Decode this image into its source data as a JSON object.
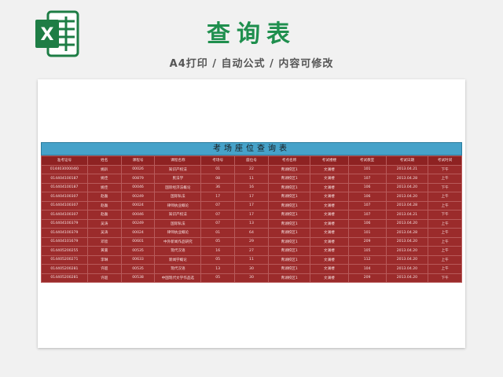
{
  "header": {
    "title": "查询表",
    "subtitle": "A4打印 / 自动公式 / 内容可修改"
  },
  "table": {
    "title": "考场座位查询表",
    "columns": [
      "准考证号",
      "姓名",
      "课程号",
      "课程名称",
      "考场号",
      "座位号",
      "考点名称",
      "考试楼楼",
      "考试教室",
      "考试日期",
      "考试时间"
    ],
    "rows": [
      [
        "01440300004l0",
        "姚趴",
        "00026",
        "知识产权法",
        "01",
        "22",
        "青湖校区1",
        "文澜楼",
        "101",
        "2013.04.21",
        "下午"
      ],
      [
        "014404100187",
        "姚佳",
        "00879",
        "民法学",
        "08",
        "11",
        "青湖校区1",
        "文澜楼",
        "107",
        "2013.04.28",
        "上午"
      ],
      [
        "014404100187",
        "姚佳",
        "00046",
        "国际经济法概论",
        "36",
        "16",
        "青湖校区1",
        "文澜楼",
        "106",
        "2013.04.20",
        "下午"
      ],
      [
        "014404100307",
        "赵磊",
        "00249",
        "国际私法",
        "17",
        "17",
        "青湖校区1",
        "文澜楼",
        "106",
        "2013.04.20",
        "上午"
      ],
      [
        "014404100307",
        "赵磊",
        "00024",
        "律师执业概论",
        "07",
        "17",
        "青湖校区1",
        "文澜楼",
        "107",
        "2013.04.28",
        "上午"
      ],
      [
        "014404100307",
        "赵磊",
        "00046",
        "知识产权法",
        "07",
        "17",
        "青湖校区1",
        "文澜楼",
        "107",
        "2013.04.21",
        "下午"
      ],
      [
        "014404100379",
        "吴涛",
        "00249",
        "国际私法",
        "07",
        "13",
        "青湖校区1",
        "文澜楼",
        "106",
        "2013.04.20",
        "上午"
      ],
      [
        "014404100379",
        "吴涛",
        "00024",
        "律师执业概论",
        "01",
        "64",
        "青湖校区1",
        "文澜楼",
        "101",
        "2013.04.28",
        "上午"
      ],
      [
        "014404101679",
        "邓欣",
        "00601",
        "中外新闻作品研究",
        "05",
        "29",
        "青湖校区1",
        "文澜楼",
        "209",
        "2013.04.20",
        "上午"
      ],
      [
        "014405200255",
        "黄嘉",
        "00535",
        "现代汉语",
        "16",
        "27",
        "青湖校区1",
        "文澜楼",
        "105",
        "2013.04.20",
        "上午"
      ],
      [
        "014405200271",
        "李琳",
        "00633",
        "新闻学概论",
        "05",
        "11",
        "青湖校区1",
        "文澜楼",
        "112",
        "2013.04.20",
        "上午"
      ],
      [
        "014405200281",
        "许超",
        "00535",
        "现代汉语",
        "13",
        "30",
        "青湖校区1",
        "文澜楼",
        "104",
        "2013.04.20",
        "上午"
      ],
      [
        "014405200281",
        "许超",
        "00538",
        "中国现代文学作品选",
        "05",
        "30",
        "青湖校区1",
        "文澜楼",
        "209",
        "2013.04.20",
        "下午"
      ]
    ]
  },
  "colors": {
    "title_green": "#1f8f4e",
    "table_header_blue": "#46a2c9",
    "table_body_red": "#9b2b2b"
  },
  "icons": {
    "logo": "excel-logo-icon"
  }
}
